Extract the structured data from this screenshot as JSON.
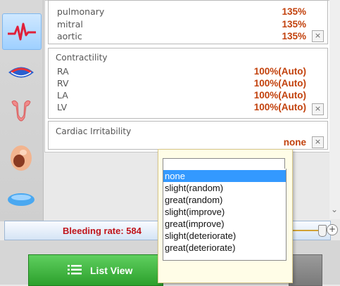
{
  "sidebar": {
    "items": [
      {
        "icon": "heart-rate-icon",
        "active": true
      },
      {
        "icon": "vessels-icon",
        "active": false
      },
      {
        "icon": "uterus-icon",
        "active": false
      },
      {
        "icon": "fetus-icon",
        "active": false
      },
      {
        "icon": "lungs-icon",
        "active": false
      }
    ]
  },
  "valves": {
    "rows": [
      {
        "label": "pulmonary",
        "value": "135%"
      },
      {
        "label": "mitral",
        "value": "135%"
      },
      {
        "label": "aortic",
        "value": "135%"
      }
    ],
    "reset_glyph": "×"
  },
  "contractility": {
    "title": "Contractility",
    "rows": [
      {
        "label": "RA",
        "value": "100%(Auto)"
      },
      {
        "label": "RV",
        "value": "100%(Auto)"
      },
      {
        "label": "LA",
        "value": "100%(Auto)"
      },
      {
        "label": "LV",
        "value": "100%(Auto)"
      }
    ],
    "reset_glyph": "×"
  },
  "cardiac_irritability": {
    "title": "Cardiac Irritability",
    "value": "none",
    "reset_glyph": "×"
  },
  "dropdown": {
    "input_value": "",
    "options": [
      "none",
      "slight(random)",
      "great(random)",
      "slight(improve)",
      "great(improve)",
      "slight(deteriorate)",
      "great(deteriorate)"
    ],
    "selected": "none"
  },
  "statusbar": {
    "text": "Bleeding rate: 584",
    "zoom_glyph": "+"
  },
  "bottom": {
    "list_view_label": "List View"
  },
  "scroll": {
    "down_arrow": "⌄"
  },
  "colors": {
    "value_orange": "#c2410c",
    "bleeding_red": "#c0141a",
    "list_view_green": "#2ca02c",
    "selection_blue": "#3399ff"
  }
}
